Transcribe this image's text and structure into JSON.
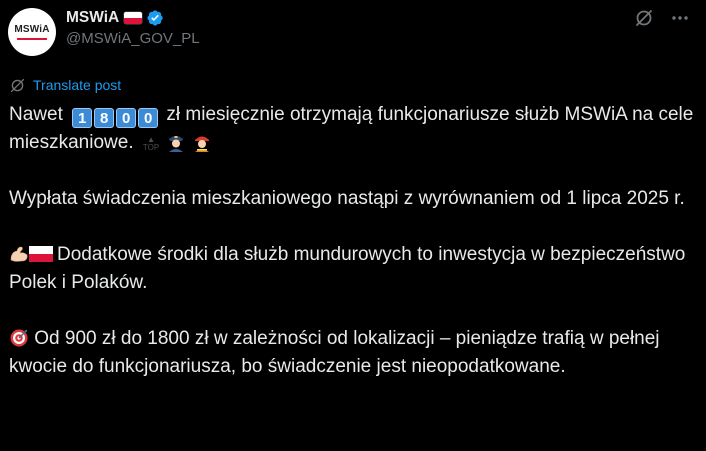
{
  "author": {
    "display_name": "MSWiA",
    "handle": "@MSWiA_GOV_PL",
    "avatar_text": "MSWiA",
    "verified": true,
    "flag": "poland-flag"
  },
  "translate": {
    "label": "Translate post"
  },
  "post": {
    "p1_before": "Nawet",
    "amount_digits": [
      "1",
      "8",
      "0",
      "0"
    ],
    "p1_after": "zł miesięcznie otrzymają  funkcjonariusze służb MSWiA na cele mieszkaniowe.",
    "p1_icons": [
      "police-officer-emoji",
      "firefighter-emoji"
    ],
    "p2": "Wypłata świadczenia mieszkaniowego nastąpi z wyrównaniem od 1 lipca 2025 r.",
    "p3": "Dodatkowe środki dla służb mundurowych to inwestycja w bezpieczeństwo Polek i Polaków.",
    "p3_icons": [
      "flexed-biceps-emoji",
      "poland-flag"
    ],
    "p4": "Od 900 zł do 1800 zł w zależności od lokalizacji – pieniądze trafią w pełnej kwocie do funkcjonariusza, bo świadczenie jest nieopodatkowane.",
    "p4_icons": [
      "direct-hit-emoji"
    ]
  },
  "colors": {
    "background": "#000000",
    "text": "#e7e9ea",
    "secondary": "#71767b",
    "link": "#1d9bf0",
    "verified": "#1d9bf0",
    "flag_red": "#dc143c"
  }
}
